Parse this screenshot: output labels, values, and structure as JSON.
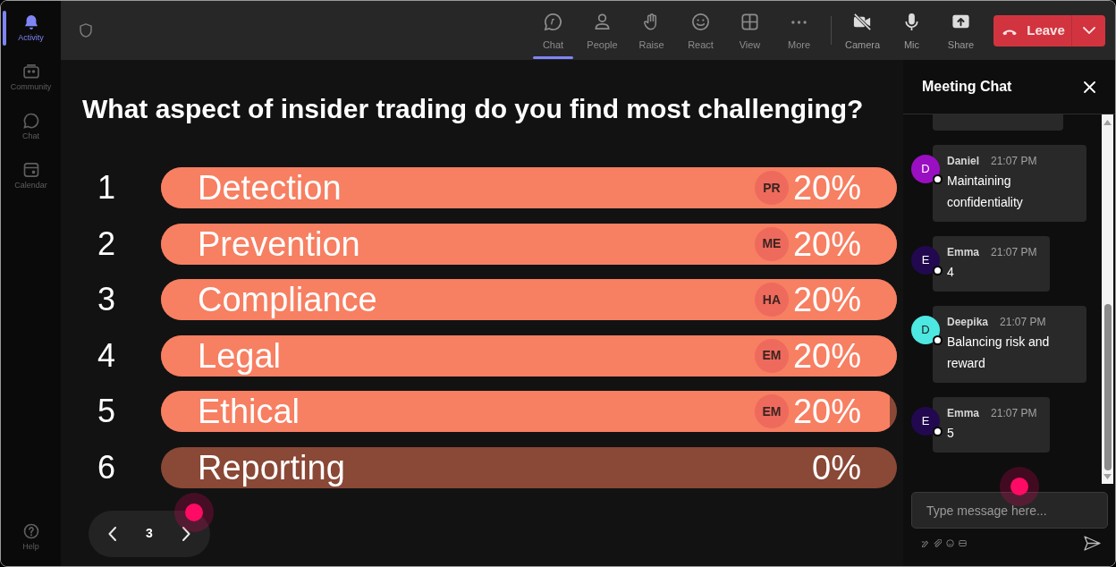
{
  "sidebar": {
    "items": [
      {
        "label": "Activity",
        "selected": true
      },
      {
        "label": "Community",
        "selected": false
      },
      {
        "label": "Chat",
        "selected": false
      },
      {
        "label": "Calendar",
        "selected": false
      }
    ],
    "help": {
      "label": "Help"
    }
  },
  "toolbar": {
    "items": [
      {
        "label": "Chat",
        "selected": true
      },
      {
        "label": "People",
        "selected": false
      },
      {
        "label": "Raise",
        "selected": false
      },
      {
        "label": "React",
        "selected": false
      },
      {
        "label": "View",
        "selected": false
      },
      {
        "label": "More",
        "selected": false
      }
    ],
    "devices": [
      {
        "label": "Camera"
      },
      {
        "label": "Mic"
      },
      {
        "label": "Share"
      }
    ],
    "leave": {
      "label": "Leave"
    }
  },
  "poll": {
    "question": "What aspect of insider trading do you find most challenging?",
    "options": [
      {
        "number": "1",
        "label": "Detection",
        "voter": "PR",
        "percent": "20%",
        "level": 1
      },
      {
        "number": "2",
        "label": "Prevention",
        "voter": "ME",
        "percent": "20%",
        "level": 1
      },
      {
        "number": "3",
        "label": "Compliance",
        "voter": "HA",
        "percent": "20%",
        "level": 1
      },
      {
        "number": "4",
        "label": "Legal",
        "voter": "EM",
        "percent": "20%",
        "level": 1
      },
      {
        "number": "5",
        "label": "Ethical",
        "voter": "EM",
        "percent": "20%",
        "level": 0.99
      },
      {
        "number": "6",
        "label": "Reporting",
        "percent": "0%",
        "level": 0
      }
    ]
  },
  "pager": {
    "page": "3"
  },
  "chat": {
    "title": "Meeting Chat",
    "messages": [
      {
        "author": "Daniel",
        "initial": "D",
        "color": "#9a0fc2",
        "time": "21:07 PM",
        "text": "Maintaining confidentiality",
        "online": true
      },
      {
        "author": "Emma",
        "initial": "E",
        "color": "#22094f",
        "time": "21:07 PM",
        "text": "4",
        "online": true
      },
      {
        "author": "Deepika",
        "initial": "D",
        "color": "#4de8e1",
        "time": "21:07 PM",
        "text": "Balancing risk and reward",
        "online": true
      },
      {
        "author": "Emma",
        "initial": "E",
        "color": "#22094f",
        "time": "21:07 PM",
        "text": "5",
        "online": true
      }
    ],
    "composer": {
      "placeholder": "Type message here..."
    }
  }
}
